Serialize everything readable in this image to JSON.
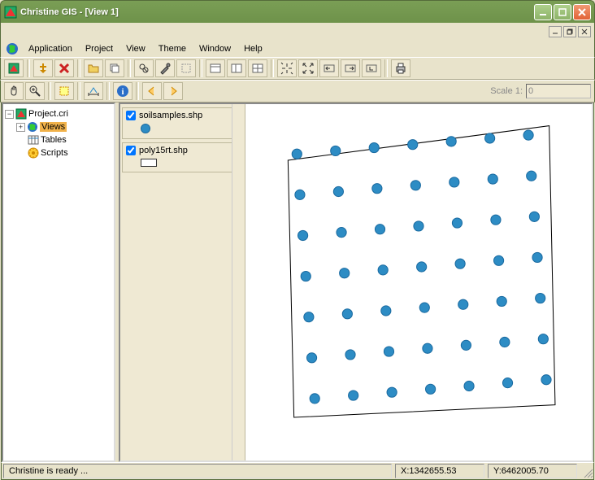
{
  "title": "Christine GIS - [View 1]",
  "menubar": [
    "Application",
    "Project",
    "View",
    "Theme",
    "Window",
    "Help"
  ],
  "toolbar1_icons": [
    "app",
    "import",
    "delete",
    "save",
    "dup",
    "find",
    "tools",
    "select-none",
    "doc1",
    "doc2",
    "doc3",
    "zoom-extent",
    "zoom-full",
    "left",
    "right",
    "nav",
    "print"
  ],
  "toolbar2_icons": [
    "pan",
    "zoom-in",
    "zoom-box",
    "measure",
    "info",
    "prev",
    "next"
  ],
  "scale_label": "Scale 1:",
  "scale_value": "0",
  "project_tree": {
    "root": {
      "label": "Project.cri"
    },
    "views": {
      "label": "Views"
    },
    "tables": {
      "label": "Tables"
    },
    "scripts": {
      "label": "Scripts"
    }
  },
  "toc": {
    "themes": [
      {
        "name": "soilsamples.shp",
        "checked": true,
        "symbol": "circle"
      },
      {
        "name": "poly15rt.shp",
        "checked": true,
        "symbol": "rect"
      }
    ]
  },
  "status": {
    "ready": "Christine is ready ...",
    "x_label": "X: ",
    "x_value": "1342655.53",
    "y_label": "Y: ",
    "y_value": "6462005.70"
  },
  "chart_data": {
    "type": "scatter",
    "title": "",
    "xlabel": "",
    "ylabel": "",
    "xlim": [
      1342400,
      1342900
    ],
    "ylim": [
      6461700,
      6462200
    ],
    "series": [
      {
        "name": "soilsamples.shp",
        "symbol": "circle",
        "color": "#2d8cc4",
        "points": [
          [
            1342445,
            6462160
          ],
          [
            1342510,
            6462165
          ],
          [
            1342575,
            6462170
          ],
          [
            1342640,
            6462175
          ],
          [
            1342705,
            6462180
          ],
          [
            1342770,
            6462185
          ],
          [
            1342835,
            6462190
          ],
          [
            1342450,
            6462095
          ],
          [
            1342515,
            6462100
          ],
          [
            1342580,
            6462105
          ],
          [
            1342645,
            6462110
          ],
          [
            1342710,
            6462115
          ],
          [
            1342775,
            6462120
          ],
          [
            1342840,
            6462125
          ],
          [
            1342455,
            6462030
          ],
          [
            1342520,
            6462035
          ],
          [
            1342585,
            6462040
          ],
          [
            1342650,
            6462045
          ],
          [
            1342715,
            6462050
          ],
          [
            1342780,
            6462055
          ],
          [
            1342845,
            6462060
          ],
          [
            1342460,
            6461965
          ],
          [
            1342525,
            6461970
          ],
          [
            1342590,
            6461975
          ],
          [
            1342655,
            6461980
          ],
          [
            1342720,
            6461985
          ],
          [
            1342785,
            6461990
          ],
          [
            1342850,
            6461995
          ],
          [
            1342465,
            6461900
          ],
          [
            1342530,
            6461905
          ],
          [
            1342595,
            6461910
          ],
          [
            1342660,
            6461915
          ],
          [
            1342725,
            6461920
          ],
          [
            1342790,
            6461925
          ],
          [
            1342855,
            6461930
          ],
          [
            1342470,
            6461835
          ],
          [
            1342535,
            6461840
          ],
          [
            1342600,
            6461845
          ],
          [
            1342665,
            6461850
          ],
          [
            1342730,
            6461855
          ],
          [
            1342795,
            6461860
          ],
          [
            1342860,
            6461865
          ],
          [
            1342475,
            6461770
          ],
          [
            1342540,
            6461775
          ],
          [
            1342605,
            6461780
          ],
          [
            1342670,
            6461785
          ],
          [
            1342735,
            6461790
          ],
          [
            1342800,
            6461795
          ],
          [
            1342865,
            6461800
          ]
        ]
      }
    ],
    "polygon": {
      "name": "poly15rt.shp",
      "coords": [
        [
          1342430,
          6462150
        ],
        [
          1342870,
          6462205
        ],
        [
          1342880,
          6461760
        ],
        [
          1342440,
          6461740
        ]
      ]
    }
  }
}
